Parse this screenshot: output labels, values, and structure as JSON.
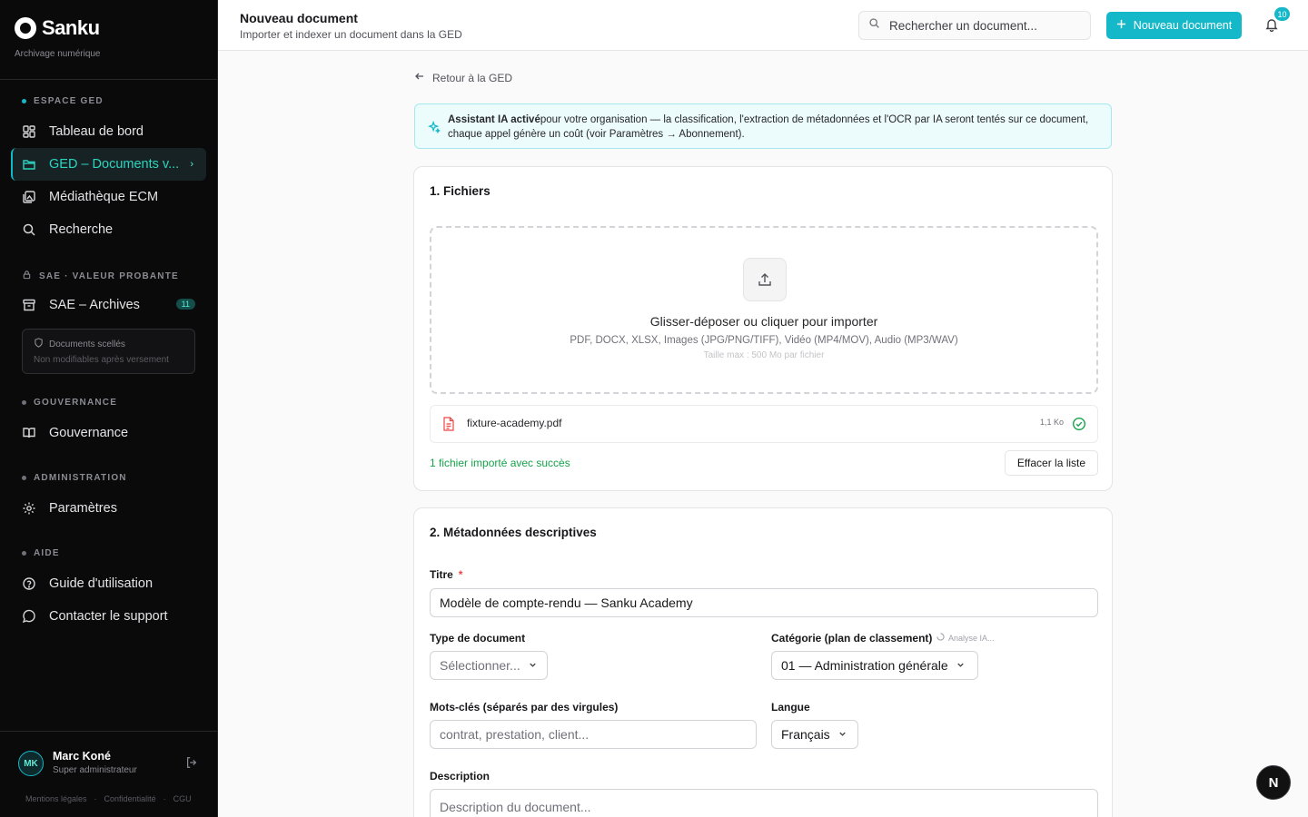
{
  "brand": {
    "name": "Sanku",
    "subtitle": "Archivage numérique"
  },
  "sidebar": {
    "sections": [
      {
        "label": "ESPACE GED"
      },
      {
        "label": "SAE · VALEUR PROBANTE"
      },
      {
        "label": "GOUVERNANCE"
      },
      {
        "label": "ADMINISTRATION"
      },
      {
        "label": "AIDE"
      }
    ],
    "items": [
      {
        "label": "Tableau de bord"
      },
      {
        "label": "GED – Documents v..."
      },
      {
        "label": "Médiathèque ECM"
      },
      {
        "label": "Recherche"
      },
      {
        "label": "SAE – Archives",
        "badge": "11"
      },
      {
        "label": "Gouvernance"
      },
      {
        "label": "Paramètres"
      },
      {
        "label": "Guide d'utilisation"
      },
      {
        "label": "Contacter le support"
      }
    ],
    "sealed": {
      "title": "Documents scellés",
      "subtitle": "Non modifiables après versement"
    },
    "user": {
      "initials": "MK",
      "name": "Marc Koné",
      "role": "Super administrateur"
    },
    "legal": [
      "Mentions légales",
      "Confidentialité",
      "CGU"
    ]
  },
  "header": {
    "title": "Nouveau document",
    "subtitle": "Importer et indexer un document dans la GED",
    "search_placeholder": "Rechercher un document...",
    "new_button": "Nouveau document",
    "notif_count": "10"
  },
  "main": {
    "back_label": "Retour à la GED",
    "ai_banner": {
      "strong": "Assistant IA activé",
      "text": "pour votre organisation — la classification, l'extraction de métadonnées et l'OCR par IA seront tentés sur ce document, chaque appel génère un coût (voir Paramètres → Abonnement)."
    },
    "files": {
      "title": "1. Fichiers",
      "drop_title": "Glisser-déposer ou cliquer pour importer",
      "formats": "PDF, DOCX, XLSX, Images (JPG/PNG/TIFF), Vidéo (MP4/MOV), Audio (MP3/WAV)",
      "max_size": "Taille max : 500 Mo par fichier",
      "uploaded": [
        {
          "name": "fixture-academy.pdf",
          "size": "1,1 Ko"
        }
      ],
      "success": "1 fichier importé avec succès",
      "clear_button": "Effacer la liste"
    },
    "metadata": {
      "title": "2. Métadonnées descriptives",
      "title_label": "Titre",
      "required_mark": "*",
      "title_value": "Modèle de compte-rendu — Sanku Academy",
      "type_label": "Type de document",
      "type_placeholder": "Sélectionner...",
      "category_label": "Catégorie (plan de classement)",
      "category_status": "Analyse IA...",
      "category_value": "01 — Administration générale",
      "keywords_label": "Mots-clés (séparés par des virgules)",
      "keywords_placeholder": "contrat, prestation, client...",
      "language_label": "Langue",
      "language_value": "Français",
      "description_label": "Description",
      "description_placeholder": "Description du document..."
    }
  },
  "fab_letter": "N",
  "colors": {
    "accent": "#14b8c8",
    "sidebar_bg": "#0a0a0b",
    "success": "#16a34a"
  }
}
